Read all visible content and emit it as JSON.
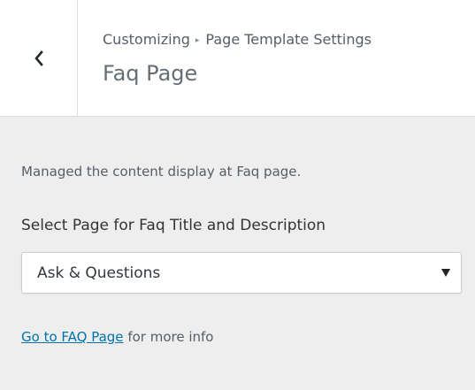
{
  "header": {
    "back_icon": "chevron-left-icon",
    "breadcrumb": {
      "parent": "Customizing",
      "separator": "▸",
      "section": "Page Template Settings"
    },
    "title": "Faq Page"
  },
  "content": {
    "description": "Managed the content display at Faq page.",
    "select_label": "Select Page for Faq Title and Description",
    "select": {
      "selected_value": "Ask & Questions",
      "arrow_icon": "dropdown-arrow-icon"
    },
    "info": {
      "link_text": "Go to FAQ Page",
      "suffix_text": " for more info"
    }
  },
  "colors": {
    "header_background": "#ffffff",
    "panel_background": "#eeeeee",
    "link": "#0073aa",
    "text": "#555d66"
  }
}
